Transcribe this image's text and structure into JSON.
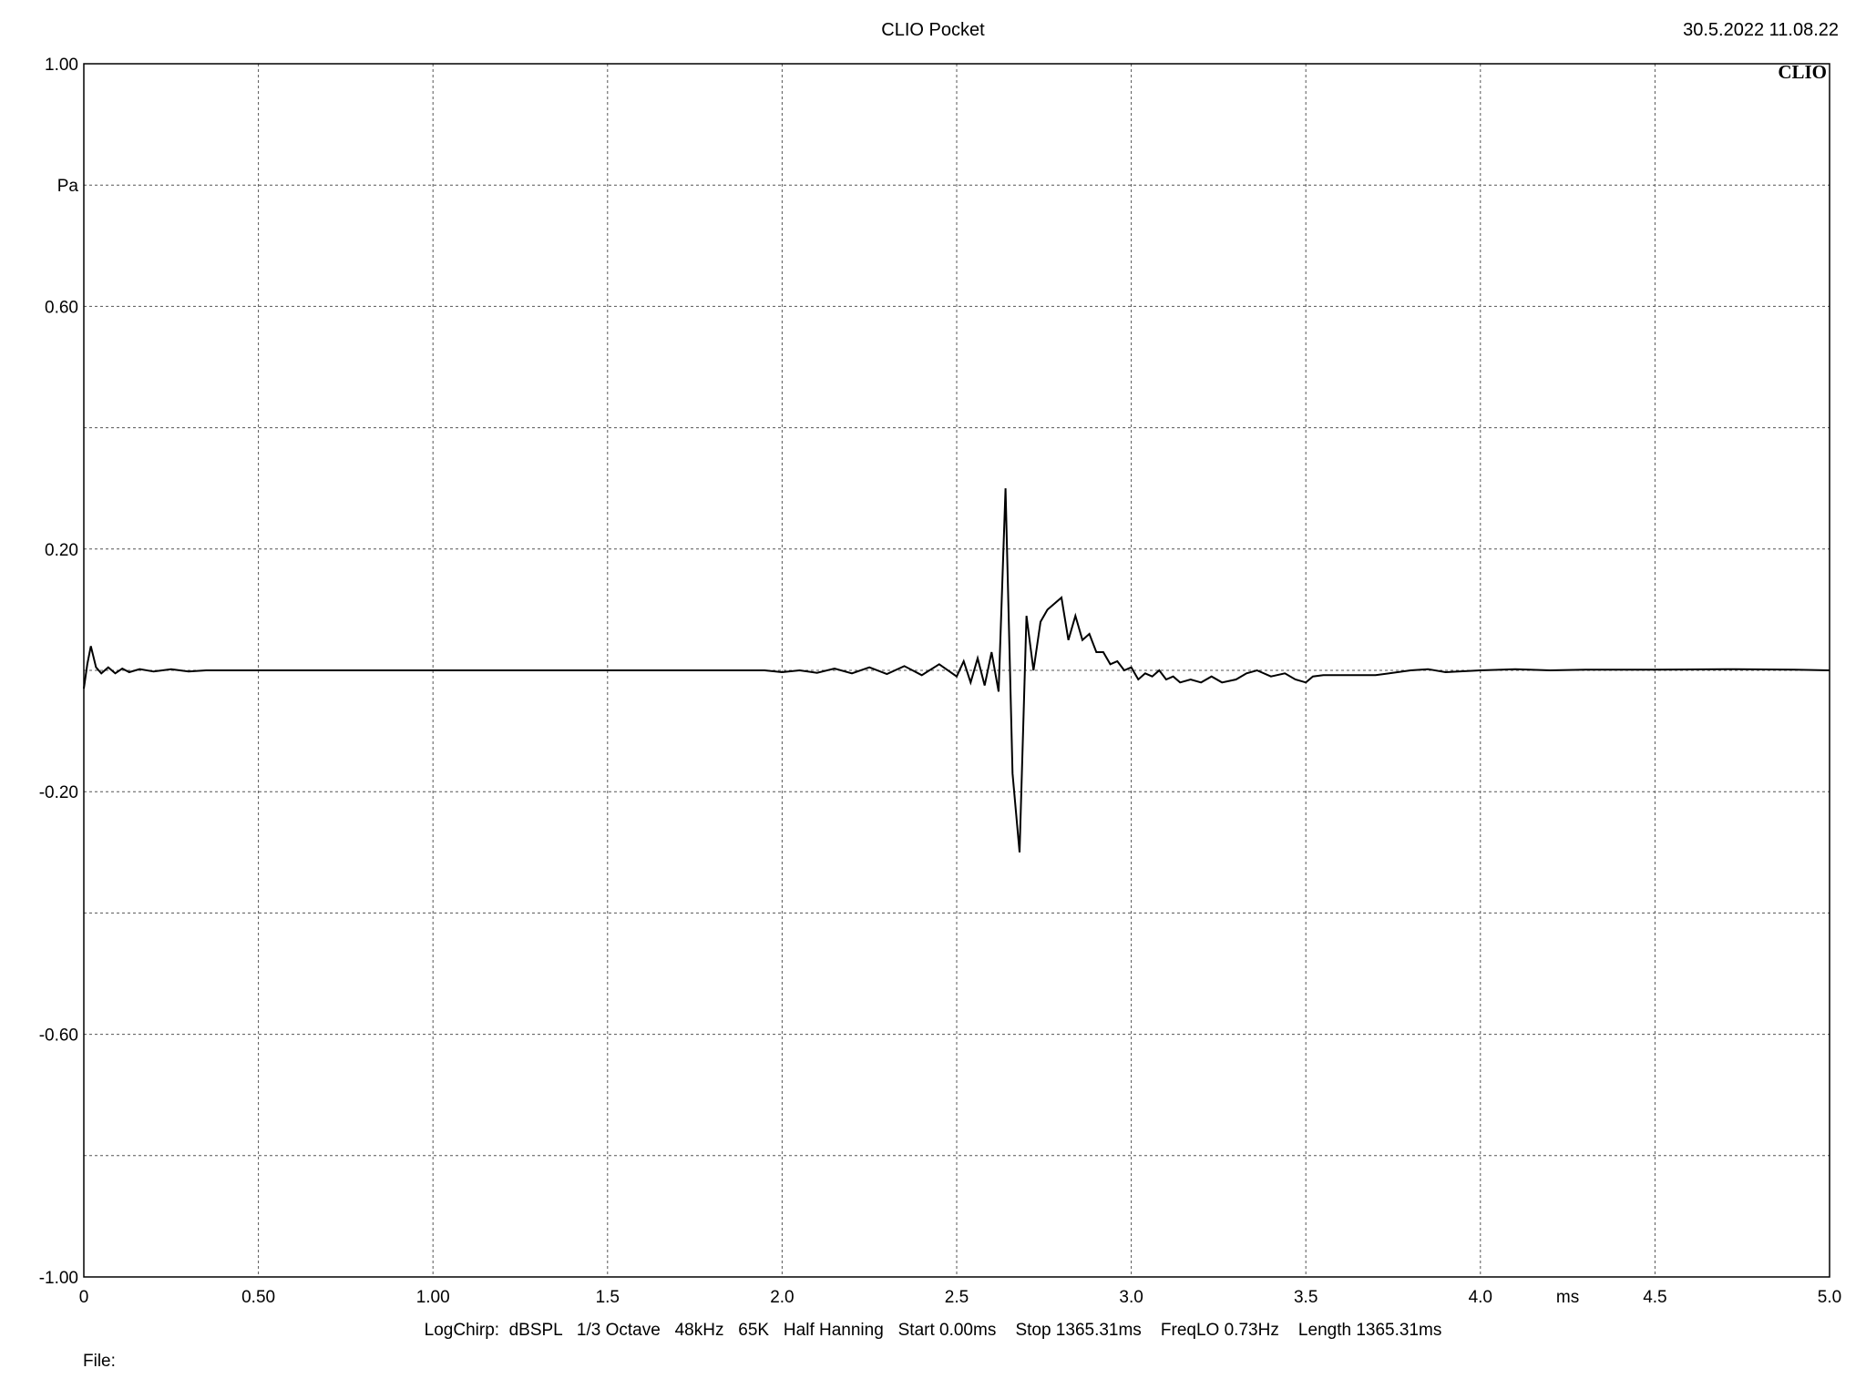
{
  "header": {
    "title": "CLIO Pocket",
    "datetime": "30.5.2022 11.08.22"
  },
  "logo_text": "CLIO",
  "footer": {
    "settings": "LogChirp:  dBSPL   1/3 Octave   48kHz   65K   Half Hanning   Start 0.00ms    Stop 1365.31ms    FreqLO 0.73Hz    Length 1365.31ms",
    "file_label": "File:"
  },
  "chart_data": {
    "type": "line",
    "title": "CLIO Pocket",
    "xlabel": "ms",
    "ylabel": "Pa",
    "xlim": [
      0,
      5.0
    ],
    "ylim": [
      -1.0,
      1.0
    ],
    "grid": true,
    "x_ticks": [
      {
        "value": 0,
        "label": "0"
      },
      {
        "value": 0.5,
        "label": "0.50"
      },
      {
        "value": 1.0,
        "label": "1.00"
      },
      {
        "value": 1.5,
        "label": "1.5"
      },
      {
        "value": 2.0,
        "label": "2.0"
      },
      {
        "value": 2.5,
        "label": "2.5"
      },
      {
        "value": 3.0,
        "label": "3.0"
      },
      {
        "value": 3.5,
        "label": "3.5"
      },
      {
        "value": 4.0,
        "label": "4.0"
      },
      {
        "value": 4.5,
        "label": "4.5"
      },
      {
        "value": 5.0,
        "label": "5.0"
      }
    ],
    "y_ticks": [
      {
        "value": 1.0,
        "label": "1.00"
      },
      {
        "value": 0.6,
        "label": "0.60"
      },
      {
        "value": 0.2,
        "label": "0.20"
      },
      {
        "value": -0.2,
        "label": "-0.20"
      },
      {
        "value": -0.6,
        "label": "-0.60"
      },
      {
        "value": -1.0,
        "label": "-1.00"
      }
    ],
    "y_gridlines": [
      1.0,
      0.8,
      0.6,
      0.4,
      0.2,
      0.0,
      -0.2,
      -0.4,
      -0.6,
      -0.8,
      -1.0
    ],
    "x_unit_label_position": 4.25,
    "y_unit_label_position": 0.8,
    "series": [
      {
        "color": "#000000",
        "x": [
          0,
          0.01,
          0.02,
          0.035,
          0.05,
          0.07,
          0.09,
          0.11,
          0.13,
          0.16,
          0.2,
          0.25,
          0.3,
          0.35,
          0.5,
          1.0,
          1.5,
          1.95,
          2.0,
          2.05,
          2.1,
          2.15,
          2.2,
          2.25,
          2.3,
          2.35,
          2.4,
          2.45,
          2.5,
          2.52,
          2.54,
          2.56,
          2.58,
          2.6,
          2.62,
          2.64,
          2.66,
          2.68,
          2.7,
          2.72,
          2.74,
          2.76,
          2.8,
          2.82,
          2.84,
          2.86,
          2.88,
          2.9,
          2.92,
          2.94,
          2.96,
          2.98,
          3.0,
          3.02,
          3.04,
          3.06,
          3.08,
          3.1,
          3.12,
          3.14,
          3.17,
          3.2,
          3.23,
          3.26,
          3.3,
          3.33,
          3.36,
          3.4,
          3.44,
          3.47,
          3.5,
          3.52,
          3.55,
          3.6,
          3.7,
          3.8,
          3.85,
          3.9,
          4.0,
          4.1,
          4.2,
          4.3,
          4.5,
          4.7,
          4.9,
          5.0
        ],
        "y": [
          -0.03,
          0.01,
          0.04,
          0.005,
          -0.005,
          0.005,
          -0.005,
          0.003,
          -0.003,
          0.002,
          -0.002,
          0.002,
          -0.002,
          0.0,
          0.0,
          0.0,
          0.0,
          0.0,
          -0.003,
          0.0,
          -0.004,
          0.003,
          -0.005,
          0.005,
          -0.006,
          0.007,
          -0.008,
          0.01,
          -0.01,
          0.015,
          -0.02,
          0.02,
          -0.025,
          0.03,
          -0.035,
          0.3,
          -0.17,
          -0.3,
          0.09,
          0.0,
          0.08,
          0.1,
          0.12,
          0.05,
          0.09,
          0.05,
          0.06,
          0.03,
          0.03,
          0.01,
          0.015,
          0.0,
          0.005,
          -0.015,
          -0.005,
          -0.01,
          0.0,
          -0.015,
          -0.01,
          -0.02,
          -0.015,
          -0.02,
          -0.01,
          -0.02,
          -0.015,
          -0.005,
          0.0,
          -0.01,
          -0.005,
          -0.015,
          -0.02,
          -0.01,
          -0.008,
          -0.008,
          -0.008,
          0.0,
          0.002,
          -0.003,
          0.0,
          0.002,
          0.0,
          0.001,
          0.001,
          0.002,
          0.001,
          0.0
        ]
      }
    ]
  }
}
